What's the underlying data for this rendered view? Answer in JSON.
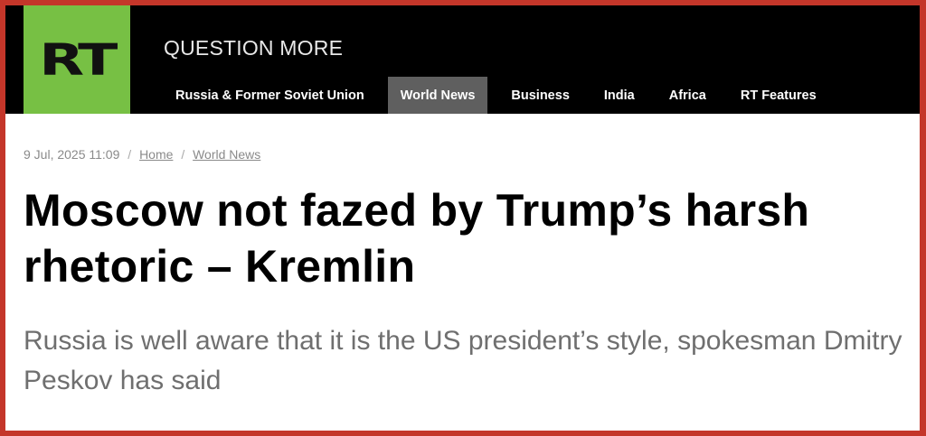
{
  "brand": {
    "logo_text": "RT",
    "tagline": "QUESTION MORE",
    "logo_color": "#77c044"
  },
  "nav": {
    "items": [
      {
        "label": "Russia & Former Soviet Union"
      },
      {
        "label": "World News",
        "active": true
      },
      {
        "label": "Business"
      },
      {
        "label": "India"
      },
      {
        "label": "Africa"
      },
      {
        "label": "RT Features"
      }
    ]
  },
  "article": {
    "timestamp": "9 Jul, 2025 11:09",
    "breadcrumb": [
      "Home",
      "World News"
    ],
    "breadcrumb_separator": "/",
    "headline": "Moscow not fazed by Trump’s harsh rhetoric – Kremlin",
    "summary": "Russia is well aware that it is the US president’s style, spokesman Dmitry Peskov has said"
  },
  "colors": {
    "frame_border": "#c4362a",
    "nav_active_bg": "#5f5f5f"
  }
}
